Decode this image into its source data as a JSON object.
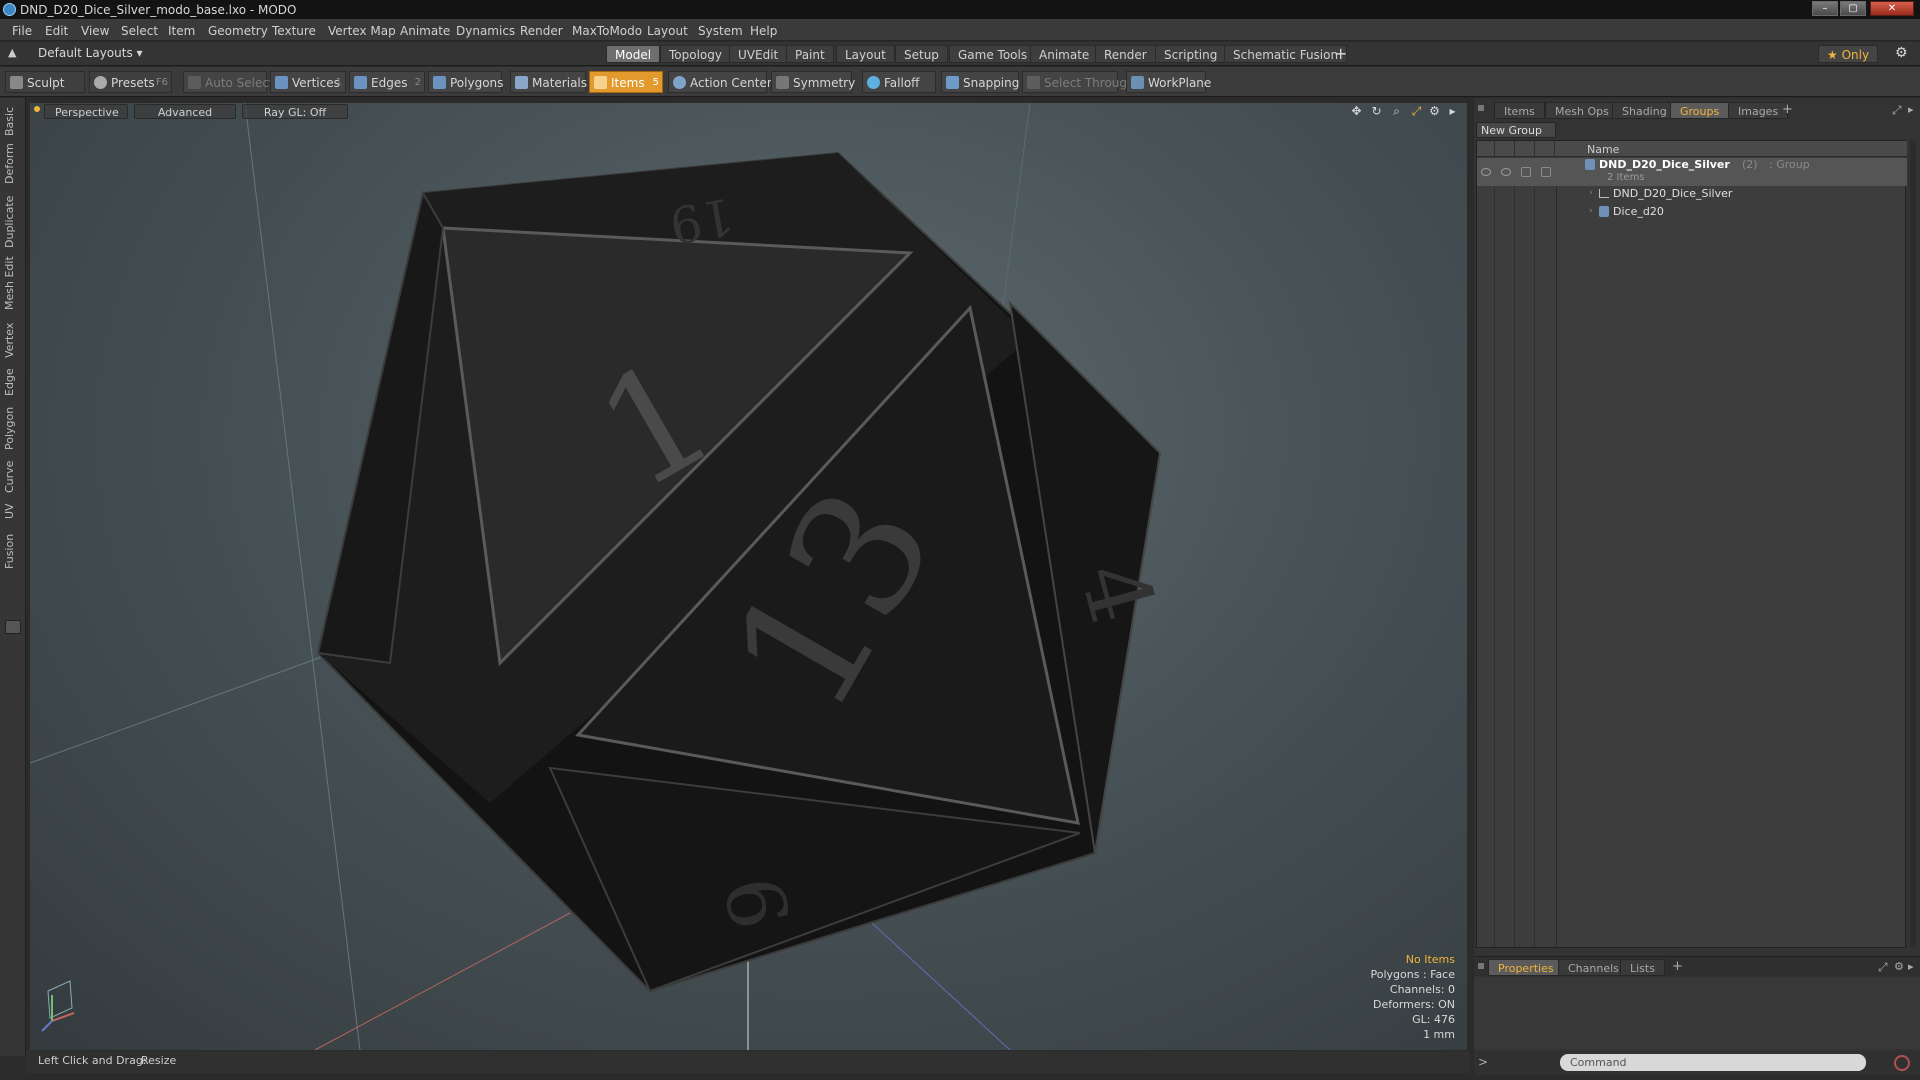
{
  "window": {
    "title": "DND_D20_Dice_Silver_modo_base.lxo - MODO",
    "min": "–",
    "max": "▢",
    "close": "✕"
  },
  "menu": [
    "File",
    "Edit",
    "View",
    "Select",
    "Item",
    "Geometry",
    "Texture",
    "Vertex Map",
    "Animate",
    "Dynamics",
    "Render",
    "MaxToModo",
    "Layout",
    "System",
    "Help"
  ],
  "layouts": {
    "dropdown": "Default Layouts ▾",
    "tabs": [
      "Model",
      "Topology",
      "UVEdit",
      "Paint",
      "Layout",
      "Setup",
      "Game Tools",
      "Animate",
      "Render",
      "Scripting",
      "Schematic Fusion"
    ],
    "active": "Model",
    "add": "+",
    "only": "★ Only",
    "gear": "⚙"
  },
  "toolbar": {
    "sculpt": "Sculpt",
    "presets": "Presets",
    "presets_key": "F6",
    "auto_select": "Auto Select",
    "vertices": "Vertices",
    "vertices_key": "1",
    "edges": "Edges",
    "edges_key": "2",
    "polygons": "Polygons",
    "materials": "Materials",
    "items": "Items",
    "items_key": "5",
    "action_center": "Action Center",
    "symmetry": "Symmetry",
    "falloff": "Falloff",
    "snapping": "Snapping",
    "select_through": "Select Through",
    "workplane": "WorkPlane"
  },
  "left_tabs": [
    "Basic",
    "Deform",
    "Duplicate",
    "Mesh Edit",
    "Vertex",
    "Edge",
    "Polygon",
    "Curve",
    "UV",
    "Fusion"
  ],
  "viewport": {
    "view": "Perspective",
    "shading": "Advanced",
    "raygl": "Ray GL: Off",
    "info": {
      "selection": "No Items",
      "polygons": "Polygons : Face",
      "channels": "Channels: 0",
      "deformers": "Deformers: ON",
      "gl": "GL: 476",
      "unit": "1 mm"
    },
    "die_numbers": [
      "1",
      "13",
      "19",
      "4",
      "9"
    ]
  },
  "right_panel": {
    "tabs": [
      "Items",
      "Mesh Ops",
      "Shading",
      "Groups",
      "Images"
    ],
    "active_tab": "Groups",
    "add": "+",
    "new_group": "New Group",
    "column_name": "Name",
    "group": {
      "name": "DND_D20_Dice_Silver",
      "count": "(2)",
      "type": ": Group",
      "sub": "2 Items"
    },
    "children": [
      "DND_D20_Dice_Silver",
      "Dice_d20"
    ],
    "bottom_tabs": [
      "Properties",
      "Channels",
      "Lists"
    ],
    "bottom_active": "Properties"
  },
  "status": {
    "hint_label": "Left Click and Drag:",
    "hint_action": "Resize"
  },
  "command": {
    "placeholder": "Command"
  }
}
